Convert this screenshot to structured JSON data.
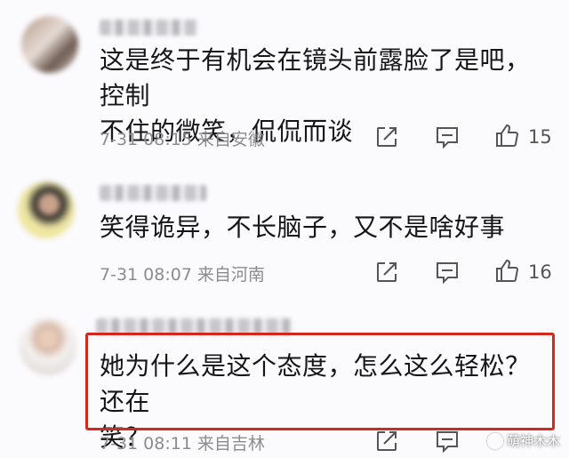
{
  "comments": [
    {
      "text_line1": "这是终于有机会在镜头前露脸了是吧，控制",
      "text_line2": "不住的微笑，侃侃而谈",
      "time": "7-31 08:15",
      "location": "来自安徽",
      "likes": "15"
    },
    {
      "text_line1": "笑得诡异，不长脑子，又不是啥好事",
      "time": "7-31 08:07",
      "location": "来自河南",
      "likes": "16"
    },
    {
      "text_line1": "她为什么是这个态度，怎么这么轻松？还在",
      "text_line2": "笑？",
      "time": "7-31 08:11",
      "location": "来自吉林"
    }
  ],
  "icons": [
    "share-icon",
    "reply-icon",
    "like-icon"
  ],
  "colors": {
    "highlight": "#d4271e",
    "meta": "#8c8c8c"
  },
  "watermark": "萌神木木"
}
